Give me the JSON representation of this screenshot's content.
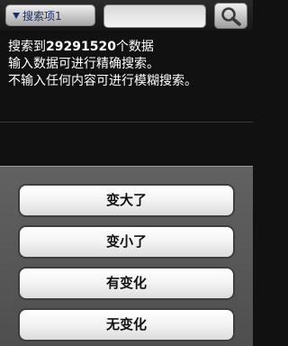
{
  "toolbar": {
    "dropdown_label": "搜索项1",
    "search_value": ""
  },
  "info": {
    "prefix": "搜索到",
    "count": "29291520",
    "suffix": "个数据",
    "line2": "输入数据可进行精确搜索。",
    "line3": "不输入任何内容可进行模糊搜索。"
  },
  "sheet": {
    "options": [
      "变大了",
      "变小了",
      "有变化",
      "无变化"
    ]
  },
  "icons": {
    "caret": "triangle-down-icon",
    "search": "magnifier-icon"
  }
}
